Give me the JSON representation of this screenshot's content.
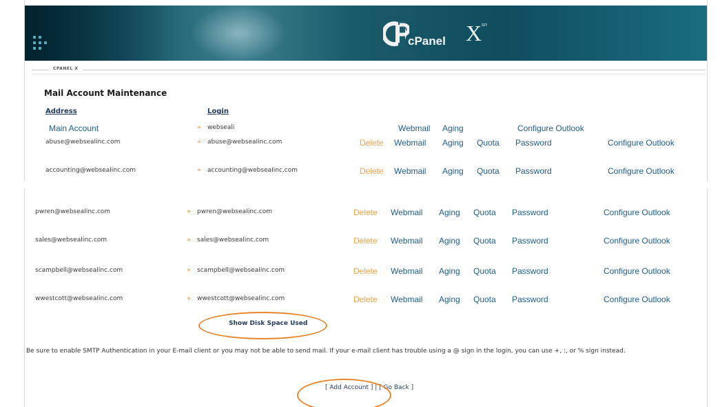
{
  "header": {
    "logo_text": "cPanel",
    "logo_x": "X",
    "logo_sup": "sn",
    "breadcrumb": "CPANEL X"
  },
  "page_title": "Mail Account Maintenance",
  "columns": {
    "address": "Address",
    "login": "Login"
  },
  "main_account": {
    "label": "Main Account",
    "arrow": "»",
    "login": "webseali",
    "actions": [
      "Webmail",
      "Aging",
      "Configure Outlook"
    ]
  },
  "accounts_top": [
    {
      "address": "abuse@webseaIinc.com",
      "arrow": "»",
      "login": "abuse@webseaIinc.com"
    },
    {
      "address": "accounting@webseaIinc.com",
      "arrow": "»",
      "login": "accounting@webseaIinc.com"
    }
  ],
  "accounts_bottom": [
    {
      "address": "pwren@webseaIinc.com",
      "arrow": "»",
      "login": "pwren@webseaIinc.com"
    },
    {
      "address": "sales@webseaIinc.com",
      "arrow": "»",
      "login": "sales@webseaIinc.com"
    },
    {
      "address": "scampbell@webseaIinc.com",
      "arrow": "»",
      "login": "scampbell@webseaIinc.com"
    },
    {
      "address": "wwestcott@webseaIinc.com",
      "arrow": "»",
      "login": "wwestcott@webseaIinc.com"
    }
  ],
  "actions": {
    "delete": "Delete",
    "webmail": "Webmail",
    "aging": "Aging",
    "quota": "Quota",
    "password": "Password",
    "configure_outlook": "Configure Outlook"
  },
  "show_disk_space": "Show Disk Space Used",
  "note": "Be sure to enable SMTP Authentication in your E-mail client or you may not be able to send mail. If your e-mail client has trouble using a @ sign in the login, you can use +, :, or % sign instead.",
  "footer_links": {
    "add_account": "[ Add Account ]",
    "separator": "|",
    "go_back": "[ Go Back ]"
  },
  "colors": {
    "link": "#1d5d8a",
    "delete": "#f2a04a",
    "highlight": "#e8852b",
    "banner": "#1a5b6b"
  }
}
